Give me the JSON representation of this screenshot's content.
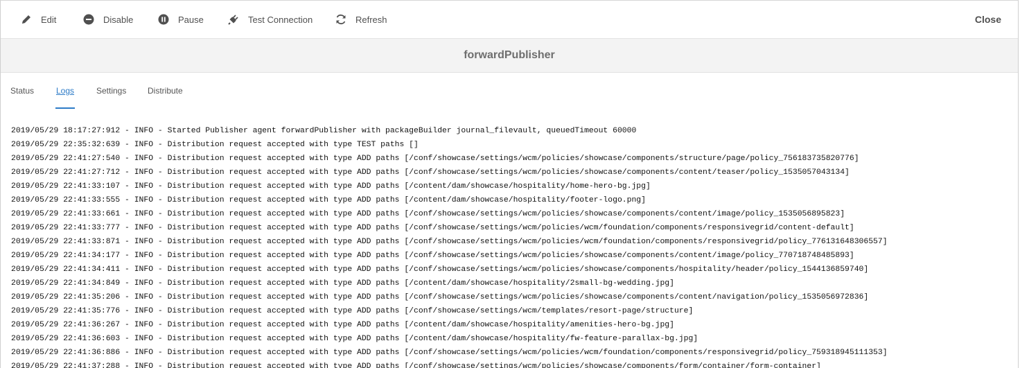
{
  "toolbar": {
    "edit_label": "Edit",
    "disable_label": "Disable",
    "pause_label": "Pause",
    "test_connection_label": "Test Connection",
    "refresh_label": "Refresh",
    "close_label": "Close"
  },
  "header": {
    "title": "forwardPublisher"
  },
  "tabs": [
    {
      "label": "Status",
      "active": false
    },
    {
      "label": "Logs",
      "active": true
    },
    {
      "label": "Settings",
      "active": false
    },
    {
      "label": "Distribute",
      "active": false
    }
  ],
  "colors": {
    "accent": "#2d7bc7"
  },
  "logs": [
    "2019/05/29 18:17:27:912 - INFO - Started Publisher agent forwardPublisher with packageBuilder journal_filevault, queuedTimeout 60000",
    "2019/05/29 22:35:32:639 - INFO - Distribution request accepted with type TEST paths []",
    "2019/05/29 22:41:27:540 - INFO - Distribution request accepted with type ADD paths [/conf/showcase/settings/wcm/policies/showcase/components/structure/page/policy_756183735820776]",
    "2019/05/29 22:41:27:712 - INFO - Distribution request accepted with type ADD paths [/conf/showcase/settings/wcm/policies/showcase/components/content/teaser/policy_1535057043134]",
    "2019/05/29 22:41:33:107 - INFO - Distribution request accepted with type ADD paths [/content/dam/showcase/hospitality/home-hero-bg.jpg]",
    "2019/05/29 22:41:33:555 - INFO - Distribution request accepted with type ADD paths [/content/dam/showcase/hospitality/footer-logo.png]",
    "2019/05/29 22:41:33:661 - INFO - Distribution request accepted with type ADD paths [/conf/showcase/settings/wcm/policies/showcase/components/content/image/policy_1535056895823]",
    "2019/05/29 22:41:33:777 - INFO - Distribution request accepted with type ADD paths [/conf/showcase/settings/wcm/policies/wcm/foundation/components/responsivegrid/content-default]",
    "2019/05/29 22:41:33:871 - INFO - Distribution request accepted with type ADD paths [/conf/showcase/settings/wcm/policies/wcm/foundation/components/responsivegrid/policy_776131648306557]",
    "2019/05/29 22:41:34:177 - INFO - Distribution request accepted with type ADD paths [/conf/showcase/settings/wcm/policies/showcase/components/content/image/policy_770718748485893]",
    "2019/05/29 22:41:34:411 - INFO - Distribution request accepted with type ADD paths [/conf/showcase/settings/wcm/policies/showcase/components/hospitality/header/policy_1544136859740]",
    "2019/05/29 22:41:34:849 - INFO - Distribution request accepted with type ADD paths [/content/dam/showcase/hospitality/2small-bg-wedding.jpg]",
    "2019/05/29 22:41:35:206 - INFO - Distribution request accepted with type ADD paths [/conf/showcase/settings/wcm/policies/showcase/components/content/navigation/policy_1535056972836]",
    "2019/05/29 22:41:35:776 - INFO - Distribution request accepted with type ADD paths [/conf/showcase/settings/wcm/templates/resort-page/structure]",
    "2019/05/29 22:41:36:267 - INFO - Distribution request accepted with type ADD paths [/content/dam/showcase/hospitality/amenities-hero-bg.jpg]",
    "2019/05/29 22:41:36:603 - INFO - Distribution request accepted with type ADD paths [/content/dam/showcase/hospitality/fw-feature-parallax-bg.jpg]",
    "2019/05/29 22:41:36:886 - INFO - Distribution request accepted with type ADD paths [/conf/showcase/settings/wcm/policies/wcm/foundation/components/responsivegrid/policy_759318945111353]",
    "2019/05/29 22:41:37:288 - INFO - Distribution request accepted with type ADD paths [/conf/showcase/settings/wcm/policies/showcase/components/form/container/form-container]"
  ]
}
